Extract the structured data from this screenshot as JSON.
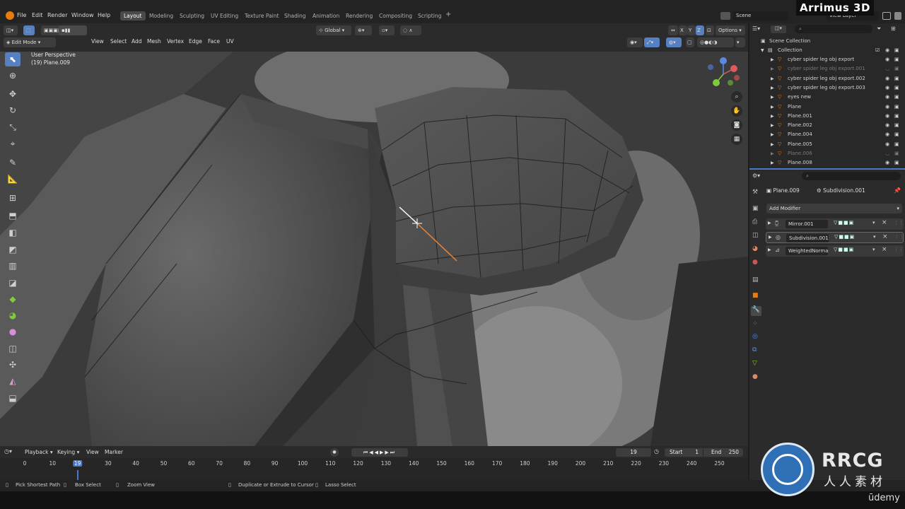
{
  "topbar": {
    "menus": [
      "File",
      "Edit",
      "Render",
      "Window",
      "Help"
    ],
    "workspaces": [
      "Layout",
      "Modeling",
      "Sculpting",
      "UV Editing",
      "Texture Paint",
      "Shading",
      "Animation",
      "Rendering",
      "Compositing",
      "Scripting"
    ],
    "add_tab": "+",
    "scene_label": "Scene",
    "view_layer_label": "View Layer",
    "watermark": "Arrimus 3D"
  },
  "viewport_header": {
    "mode": "Edit Mode",
    "menus": [
      "View",
      "Select",
      "Add",
      "Mesh",
      "Vertex",
      "Edge",
      "Face",
      "UV"
    ],
    "transform_orientation": "Global",
    "axis_x": "X",
    "axis_y": "Y",
    "axis_z": "Z",
    "options": "Options"
  },
  "viewport": {
    "perspective_label": "User Perspective",
    "object_label": "(19) Plane.009"
  },
  "outliner": {
    "scene_collection": "Scene Collection",
    "collection": "Collection",
    "items": [
      {
        "label": "cyber spider leg obj export",
        "dim": false
      },
      {
        "label": "cyber spider leg obj export.001",
        "dim": true
      },
      {
        "label": "cyber spider leg obj export.002",
        "dim": false
      },
      {
        "label": "cyber spider leg obj export.003",
        "dim": false
      },
      {
        "label": "eyes new",
        "dim": false
      },
      {
        "label": "Plane",
        "dim": false
      },
      {
        "label": "Plane.001",
        "dim": false
      },
      {
        "label": "Plane.002",
        "dim": false
      },
      {
        "label": "Plane.004",
        "dim": false
      },
      {
        "label": "Plane.005",
        "dim": false
      },
      {
        "label": "Plane.006",
        "dim": true
      },
      {
        "label": "Plane.008",
        "dim": false
      }
    ]
  },
  "properties": {
    "object_name": "Plane.009",
    "active_modifier": "Subdivision.001",
    "add_modifier": "Add Modifier",
    "modifiers": [
      "Mirror.001",
      "Subdivision.001",
      "WeightedNormal"
    ]
  },
  "timeline": {
    "menus": [
      "Playback",
      "Keying",
      "View",
      "Marker"
    ],
    "current_frame": "19",
    "start_label": "Start",
    "start": "1",
    "end_label": "End",
    "end": "250",
    "ticks": [
      "0",
      "10",
      "19",
      "30",
      "40",
      "50",
      "60",
      "70",
      "80",
      "90",
      "100",
      "110",
      "120",
      "130",
      "140",
      "150",
      "160",
      "170",
      "180",
      "190",
      "200",
      "210",
      "220",
      "230",
      "240",
      "250"
    ]
  },
  "statusbar": {
    "items": [
      "Pick Shortest Path",
      "Box Select",
      "Zoom View",
      "Duplicate or Extrude to Cursor",
      "Lasso Select"
    ]
  },
  "watermark_logo": {
    "brand": "RRCG",
    "sub": "人人素材",
    "udemy": "ūdemy"
  },
  "colors": {
    "accent": "#5680c2",
    "active_workspace": "#4a4a4a",
    "selected_edge": "#e8843a",
    "frame_marker": "#4c78c8"
  }
}
